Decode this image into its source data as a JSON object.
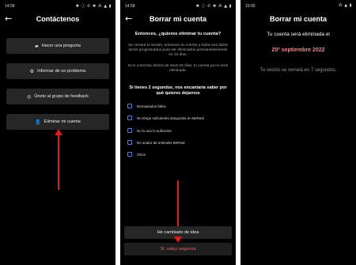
{
  "screen1": {
    "status_time": "14:58",
    "status_icons": "✱ ⓘ ✆ ✱ ⁂ ▲ ▮",
    "title": "Contáctenos",
    "buttons": [
      {
        "label": "Hacer una pregunta",
        "icon": "chat-icon"
      },
      {
        "label": "Informar de un problema",
        "icon": "gear-icon"
      },
      {
        "label": "Únete al grupo de feedback",
        "icon": "whatsapp-icon"
      },
      {
        "label": "Eliminar mi cuenta",
        "icon": "remove-user-icon"
      }
    ]
  },
  "screen2": {
    "status_time": "14:58",
    "status_icons": "✱ ⓘ ✆ ✱ ⁂ ▲ ▮",
    "title": "Borrar mi cuenta",
    "question": "Entonces, ¿quieres eliminar tu cuenta?",
    "para1": "Se cerrará tu sesión, entonces su cuenta y todos sus datos serán programados para ser eliminados permanentemente en 15 días.",
    "para2": "Si te conectas dentro de esos 15 días, tu cuenta ya no será eliminada.",
    "ask": "Si tienes 2 segundos, nos encantaría saber por qué quieres dejarnos",
    "options": [
      "Demasiados fallos",
      "No tengo suficientes amigos/as en BeReal",
      "No lo uso lo suficiente",
      "No acabo de entender BeReal",
      "Otros"
    ],
    "changed_mind": "He cambiado de idea",
    "confirm": "Sí, estoy seguro/a"
  },
  "screen3": {
    "status_time": "15:00",
    "status_icons": "⁂ ▲ ▮",
    "title": "Borrar mi cuenta",
    "message": "Tu cuenta será eliminada el",
    "date": "20º septiembre 2022",
    "logout_note": "Tu sesión se cerrará en 7 segundos."
  },
  "colors": {
    "annotation_arrow": "#e01b1b",
    "checkbox_border": "#4d7fe6",
    "date_text": "#e88a8a"
  }
}
